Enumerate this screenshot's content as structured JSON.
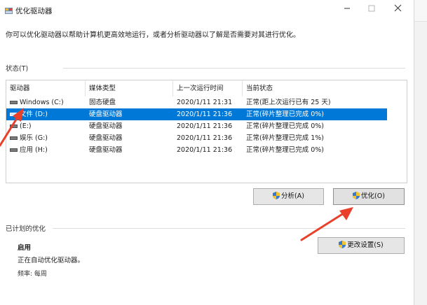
{
  "window": {
    "title": "优化驱动器"
  },
  "description": "你可以优化驱动器以帮助计算机更高效地运行，或者分析驱动器以了解是否需要对其进行优化。",
  "status": {
    "label": "状态(T)",
    "columns": [
      "驱动器",
      "媒体类型",
      "上一次运行时间",
      "当前状态"
    ],
    "rows": [
      {
        "drive": "Windows (C:)",
        "media": "固态硬盘",
        "last_run": "2020/1/11 21:31",
        "state": "正常(距上次运行已有 25 天)",
        "selected": false
      },
      {
        "drive": "文件 (D:)",
        "media": "硬盘驱动器",
        "last_run": "2020/1/11 21:36",
        "state": "正常(碎片整理已完成 0%)",
        "selected": true
      },
      {
        "drive": "(E:)",
        "media": "硬盘驱动器",
        "last_run": "2020/1/11 21:36",
        "state": "正常(碎片整理已完成 0%)",
        "selected": false
      },
      {
        "drive": "娱乐 (G:)",
        "media": "硬盘驱动器",
        "last_run": "2020/1/11 21:36",
        "state": "正常(碎片整理已完成 1%)",
        "selected": false
      },
      {
        "drive": "应用 (H:)",
        "media": "硬盘驱动器",
        "last_run": "2020/1/11 21:36",
        "state": "正常(碎片整理已完成 0%)",
        "selected": false
      }
    ]
  },
  "buttons": {
    "analyze": "分析(A)",
    "optimize": "优化(O)",
    "change_settings": "更改设置(S)"
  },
  "scheduled": {
    "label": "已计划的优化",
    "status": "启用",
    "detail": "正在自动优化驱动器。",
    "frequency": "频率: 每周"
  },
  "colors": {
    "selection": "#0078d7",
    "annotation_arrow": "#e8402a"
  }
}
